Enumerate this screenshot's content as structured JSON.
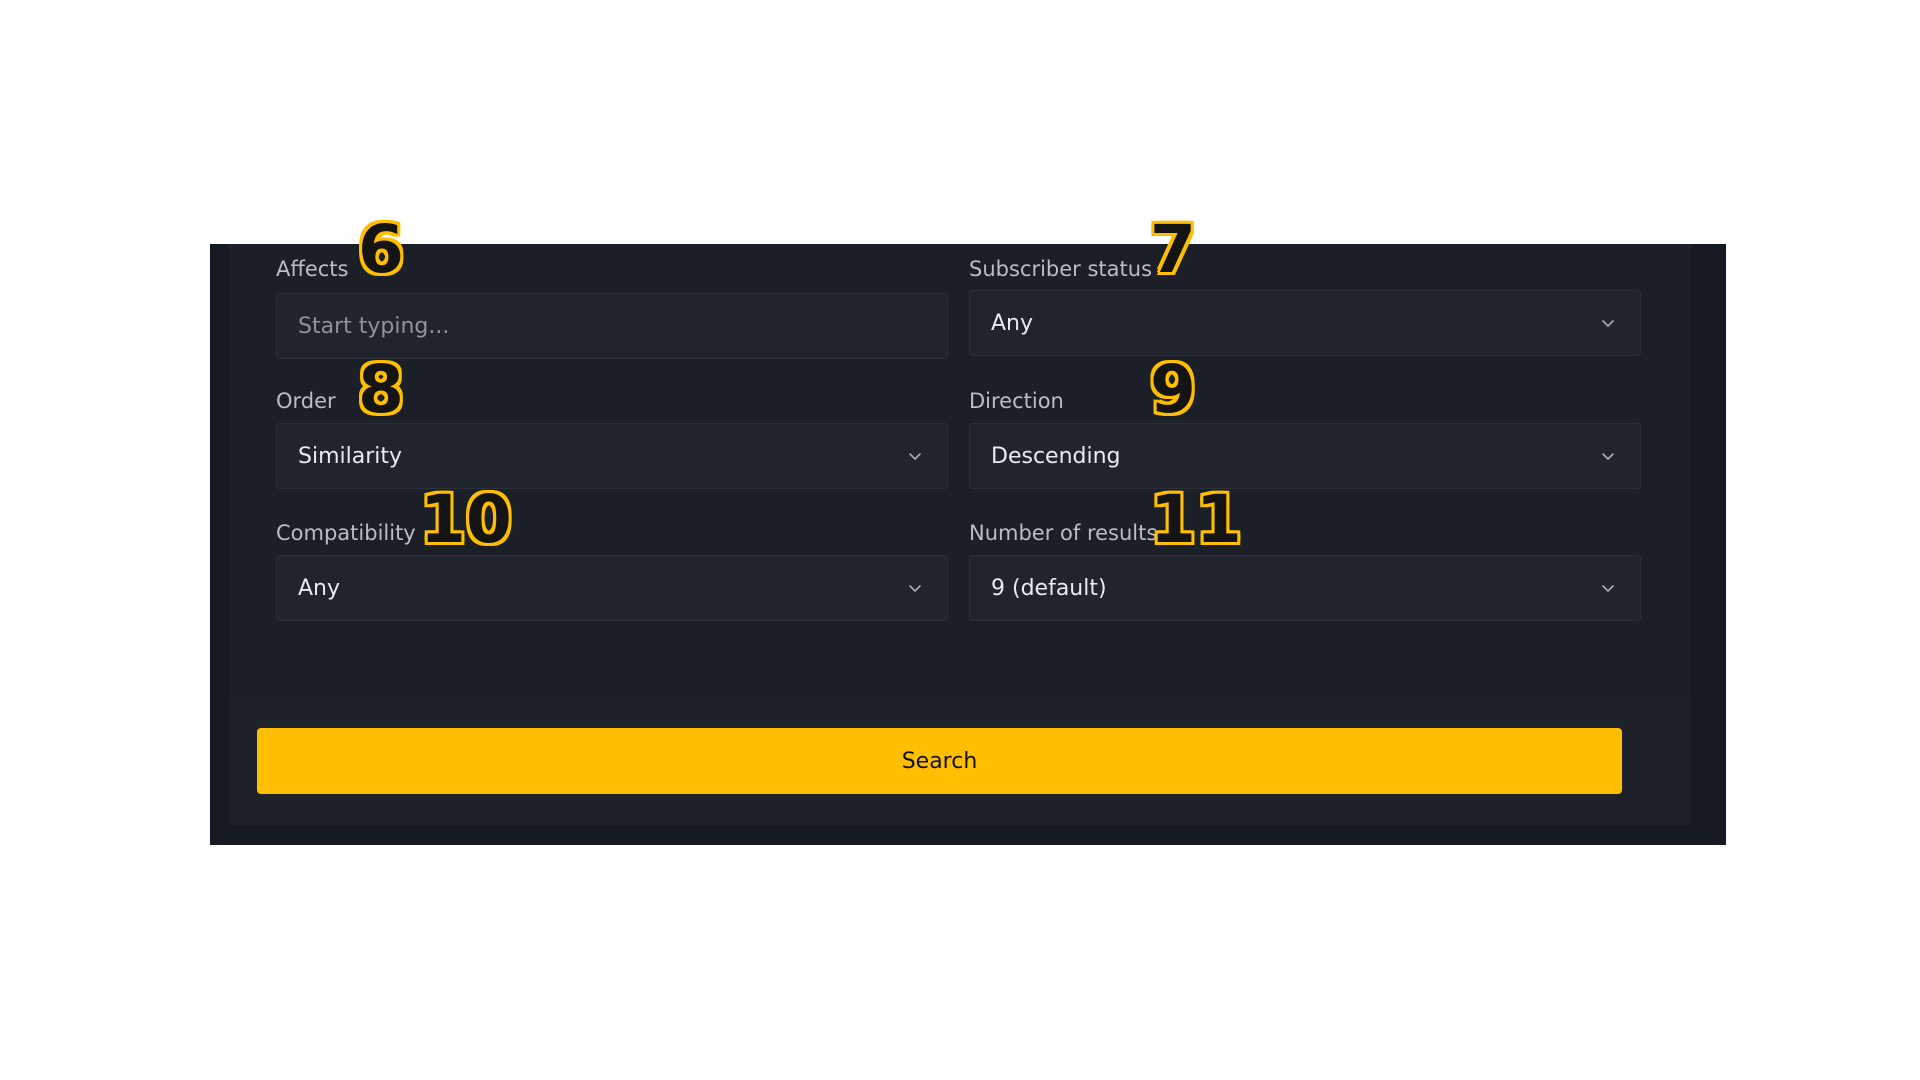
{
  "form": {
    "affects": {
      "label": "Affects",
      "placeholder": "Start typing...",
      "value": ""
    },
    "subscriber_status": {
      "label": "Subscriber status",
      "value": "Any"
    },
    "order": {
      "label": "Order",
      "value": "Similarity"
    },
    "direction": {
      "label": "Direction",
      "value": "Descending"
    },
    "compatibility": {
      "label": "Compatibility",
      "value": "Any"
    },
    "number_of_results": {
      "label": "Number of results",
      "value": "9 (default)"
    },
    "search_label": "Search"
  },
  "annotations": [
    "6",
    "7",
    "8",
    "9",
    "10",
    "11"
  ],
  "icons": {
    "dropdown": "chevron-down-icon"
  },
  "colors": {
    "accent": "#ffbe00",
    "panel": "#1b1f27",
    "frame": "#161a21",
    "control": "#20242d"
  }
}
